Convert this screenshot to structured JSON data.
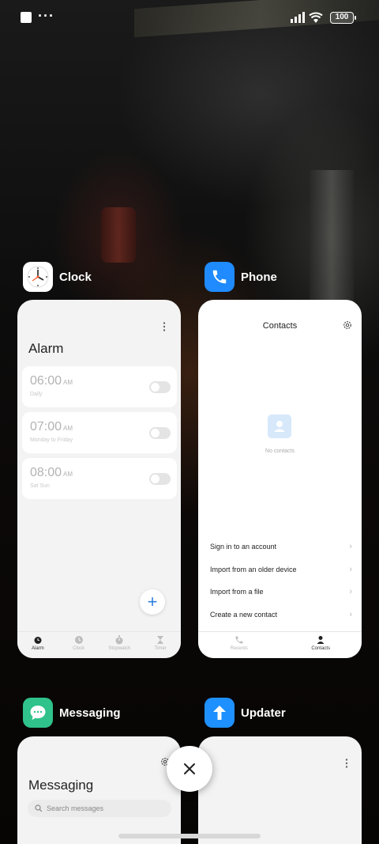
{
  "status_bar": {
    "dots": "···",
    "battery": "100"
  },
  "apps": {
    "clock": {
      "name": "Clock",
      "screen_title": "Alarm",
      "alarms": [
        {
          "time": "06:00",
          "ampm": "AM",
          "repeat": "Daily"
        },
        {
          "time": "07:00",
          "ampm": "AM",
          "repeat": "Monday to Friday"
        },
        {
          "time": "08:00",
          "ampm": "AM",
          "repeat": "Sat Sun"
        }
      ],
      "add_label": "+",
      "nav": [
        "Alarm",
        "Clock",
        "Stopwatch",
        "Timer"
      ]
    },
    "phone": {
      "name": "Phone",
      "screen_title": "Contacts",
      "empty_text": "No contacts",
      "menu": [
        "Sign in to an account",
        "Import from an older device",
        "Import from a file",
        "Create a new contact"
      ],
      "nav": [
        "Recents",
        "Contacts"
      ]
    },
    "messaging": {
      "name": "Messaging",
      "screen_title": "Messaging",
      "search_placeholder": "Search messages"
    },
    "updater": {
      "name": "Updater"
    }
  },
  "colors": {
    "clock_icon_bg": "#ffffff",
    "phone_icon_bg": "#1f8bff",
    "messaging_icon_bg": "#2fc28a",
    "updater_icon_bg": "#1e90ff",
    "accent": "#2f7fe0"
  },
  "icons": {
    "clock": "clock-face-icon",
    "phone": "phone-handset-icon",
    "messaging": "chat-bubble-icon",
    "updater": "arrow-up-icon",
    "close": "close-icon"
  }
}
